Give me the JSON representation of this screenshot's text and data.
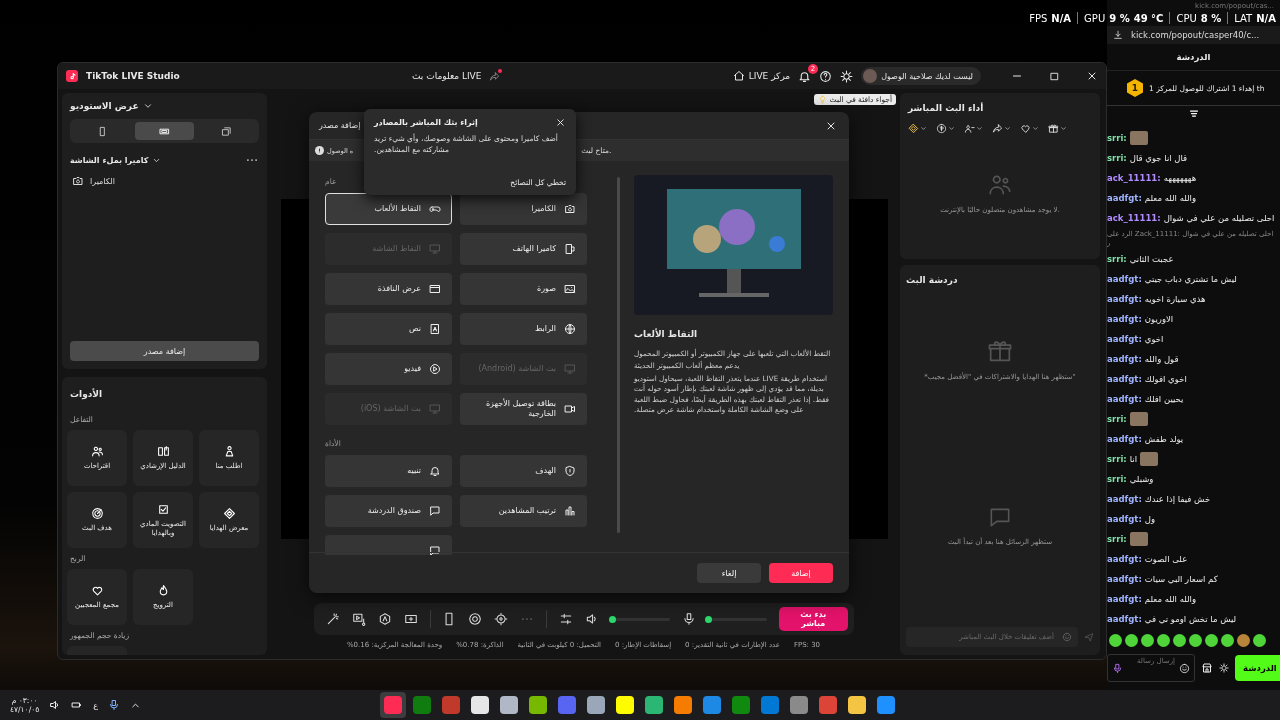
{
  "hud": {
    "fps_label": "FPS",
    "fps_value": "N/A",
    "gpu_label": "GPU",
    "gpu_usage": "9 %",
    "gpu_temp": "49 °C",
    "cpu_label": "CPU",
    "cpu_value": "8 %",
    "lat_label": "LAT",
    "lat_value": "N/A"
  },
  "studio": {
    "title": "TikTok LIVE Studio",
    "stream_info": "معلومات بث LIVE",
    "live_center": "LIVE مركز",
    "notification_count": "2",
    "account": "ليست لديك صلاحية الوصول",
    "studio_view": "عرض الاستوديو",
    "layouts": [
      {
        "kind": "portrait",
        "selected": false
      },
      {
        "kind": "landscape",
        "selected": true
      },
      {
        "kind": "dual",
        "selected": false
      }
    ],
    "scene": "كاميرا بملء الشاشة",
    "sources": [
      {
        "label": "الكاميرا",
        "kind": "camera"
      }
    ],
    "add_source": "إضافة مصدر",
    "tools_title": "الأدوات",
    "tool_groups": [
      {
        "title": "التفاعل",
        "items": [
          {
            "label": "اطلب منا",
            "kind": "pin-person"
          },
          {
            "label": "الدليل الإرشادي",
            "kind": "book"
          },
          {
            "label": "اقتراحات",
            "kind": "people"
          },
          {
            "label": "معرض الهدايا",
            "kind": "gem"
          },
          {
            "label": "التصويت المادي وبالهدايا",
            "kind": "check"
          },
          {
            "label": "هدف البث",
            "kind": "target"
          }
        ]
      },
      {
        "title": "الربح",
        "items": [
          {
            "label": "الترويج",
            "kind": "flame"
          },
          {
            "label": "مجمع المعجبين",
            "kind": "hearts"
          }
        ]
      },
      {
        "title": "زيادة حجم الجمهور",
        "items": [
          {
            "kind": "people"
          }
        ]
      }
    ],
    "hint": "أجواء دافئة في البث",
    "toolbar": [
      {
        "kind": "wand"
      },
      {
        "kind": "media"
      },
      {
        "kind": "ai"
      },
      {
        "kind": "screen-plus"
      },
      {
        "kind": "divider"
      },
      {
        "kind": "phone"
      },
      {
        "kind": "record"
      },
      {
        "kind": "focus"
      },
      {
        "kind": "more"
      },
      {
        "kind": "divider"
      },
      {
        "kind": "sliders"
      }
    ],
    "speaker_slider": {
      "level": 0.02
    },
    "mic_slider": {
      "level": 0
    },
    "go_live": "بدء بث مباشر",
    "stats": [
      "FPS: 30",
      "عدد الإطارات في ثانية التقدير: 0",
      "إسقاطات الإطار: 0",
      "التحميل: 0 كيلوبت في الثانية",
      "الذاكرة: 0.78%",
      "وحدة المعالجة المركزية: 0.16%"
    ],
    "performance": {
      "title": "أداء البث المباشر",
      "metrics": [
        {
          "kind": "gem"
        },
        {
          "kind": "coin"
        },
        {
          "kind": "viewers"
        },
        {
          "kind": "share"
        },
        {
          "kind": "heart"
        },
        {
          "kind": "gift"
        }
      ],
      "empty": "لا يوجد مشاهدون متصلون حاليًا بالإنترنت."
    },
    "live_chat": {
      "title": "دردشة البث",
      "gifts_empty": "*ستظهر هنا الهدايا والاشتراكات في \"الأفضل مجيب\"",
      "messages_empty": "ستظهر الرسائل هنا بعد أن تبدأ البث",
      "placeholder": "أضف تعليقات خلال البث المباشر"
    }
  },
  "modal": {
    "title": "إضافة مصدر",
    "notice_start": "ه الوصول",
    "notice_end": "متاح لبث.",
    "sections": [
      {
        "title": "عام",
        "items": [
          {
            "label": "الكاميرا",
            "kind": "camera",
            "selected": false,
            "disabled": false
          },
          {
            "label": "التقاط الألعاب",
            "kind": "gamepad",
            "selected": true,
            "disabled": false
          },
          {
            "label": "كاميرا الهاتف",
            "kind": "phone-camera",
            "selected": false,
            "disabled": false
          },
          {
            "label": "التقاط الشاشة",
            "kind": "monitor",
            "selected": false,
            "disabled": true
          },
          {
            "label": "صورة",
            "kind": "image",
            "selected": false,
            "disabled": false
          },
          {
            "label": "عرض النافذة",
            "kind": "window",
            "selected": false,
            "disabled": false
          },
          {
            "label": "الرابط",
            "kind": "globe",
            "selected": false,
            "disabled": false
          },
          {
            "label": "نص",
            "kind": "text",
            "selected": false,
            "disabled": false
          },
          {
            "label": "بث الشاشة (Android)",
            "kind": "monitor",
            "selected": false,
            "disabled": true
          },
          {
            "label": "فيديو",
            "kind": "play",
            "selected": false,
            "disabled": false
          },
          {
            "label": "بطاقة توصيل الأجهزة الخارجية",
            "kind": "video-card",
            "selected": false,
            "disabled": false
          },
          {
            "label": "بث الشاشة (iOS)",
            "kind": "monitor",
            "selected": false,
            "disabled": true
          }
        ]
      },
      {
        "title": "الأداة",
        "items": [
          {
            "label": "الهدف",
            "kind": "shield",
            "selected": false,
            "disabled": false
          },
          {
            "label": "تنبيه",
            "kind": "bell",
            "selected": false,
            "disabled": false
          },
          {
            "label": "ترتيب المشاهدين",
            "kind": "bars",
            "selected": false,
            "disabled": false
          },
          {
            "label": "صندوق الدردشة",
            "kind": "chat-box",
            "selected": false,
            "disabled": false
          },
          {
            "kind": "chat-box",
            "selected": false,
            "disabled": false
          }
        ]
      }
    ],
    "preview": {
      "title": "التقاط الألعاب",
      "paragraphs": [
        "التقط الألعاب التي تلعبها على جهاز الكمبيوتر أو الكمبيوتر المحمول",
        "يدعم معظم ألعاب الكمبيوتر الحديثة",
        "استخدام طريقة LIVE عندما يتعذر التقاط اللعبة، سيحاول استوديو بديلة، مما قد يؤدي إلى ظهور شاشة لعبتك بإطار أسود حوله أنت فقط. إذا تعذر التقاط لعبتك بهذه الطريقة أيضًا، فحاول ضبط اللعبة على وضع الشاشة الكاملة واستخدام شاشة عرض متصلة."
      ]
    },
    "buttons": [
      {
        "label": "إضافة",
        "kind": "primary"
      },
      {
        "label": "إلغاء",
        "kind": "secondary"
      }
    ]
  },
  "tip": {
    "title": "إثراء بثك المباشر بالمصادر",
    "body": "أضف كاميرا ومحتوى على الشاشة وصوصك، وأي شيء تريد مشاركته مع المشاهدين.",
    "skip": "تخطي كل النصائح"
  },
  "chat": {
    "tab_title": "kick.com/popout/cas...",
    "url": "kick.com/popout/casper40/c...",
    "title": "الدردشة",
    "pinned_rank": "1",
    "pinned_text": "إهداء 1 اشتراك للوصول للمركز 1 th",
    "messages": [
      {
        "kind": "image",
        "user": "srri:",
        "color": "#7fe0a8"
      },
      {
        "kind": "text",
        "user": "srri:",
        "color": "#7fe0a8",
        "text": "قال انا جوي قال"
      },
      {
        "kind": "text",
        "user": "ack_11111:",
        "color": "#b08cff",
        "text": "هههههههه"
      },
      {
        "kind": "text",
        "user": "aadfgt:",
        "color": "#9fb4ff",
        "text": "والله الله معلم"
      },
      {
        "kind": "text",
        "user": "ack_11111:",
        "color": "#b08cff",
        "text": "احلى تصليله من علي في شوال"
      },
      {
        "kind": "reply",
        "text": "الرد على Zack_11111: احلى تصليله من علي في شوال ر"
      },
      {
        "kind": "text",
        "user": "srri:",
        "color": "#7fe0a8",
        "text": "عجبت الثاني"
      },
      {
        "kind": "text",
        "user": "aadfgt:",
        "color": "#9fb4ff",
        "text": "ليش ما تشتري دباب جيتي"
      },
      {
        "kind": "text",
        "user": "aadfgt:",
        "color": "#9fb4ff",
        "text": "هذي سيارة اخويه"
      },
      {
        "kind": "text",
        "user": "aadfgt:",
        "color": "#9fb4ff",
        "text": "الاوريون"
      },
      {
        "kind": "text",
        "user": "aadfgt:",
        "color": "#9fb4ff",
        "text": "اخوي"
      },
      {
        "kind": "text",
        "user": "aadfgt:",
        "color": "#9fb4ff",
        "text": "قول والله"
      },
      {
        "kind": "text",
        "user": "aadfgt:",
        "color": "#9fb4ff",
        "text": "اخوي افولك"
      },
      {
        "kind": "text",
        "user": "aadfgt:",
        "color": "#9fb4ff",
        "text": "يحيين افلك"
      },
      {
        "kind": "image",
        "user": "srri:",
        "color": "#7fe0a8"
      },
      {
        "kind": "text",
        "user": "aadfgt:",
        "color": "#9fb4ff",
        "text": "يولد طفش"
      },
      {
        "kind": "text-image",
        "user": "srri:",
        "color": "#7fe0a8",
        "text": "انا"
      },
      {
        "kind": "text",
        "user": "srri:",
        "color": "#7fe0a8",
        "text": "وشبلي"
      },
      {
        "kind": "text",
        "user": "aadfgt:",
        "color": "#9fb4ff",
        "text": "خش فيفا إذا عندك"
      },
      {
        "kind": "text",
        "user": "aadfgt:",
        "color": "#9fb4ff",
        "text": "ول"
      },
      {
        "kind": "image",
        "user": "srri:",
        "color": "#7fe0a8"
      },
      {
        "kind": "text",
        "user": "aadfgt:",
        "color": "#9fb4ff",
        "text": "على الصوت"
      },
      {
        "kind": "text",
        "user": "aadfgt:",
        "color": "#9fb4ff",
        "text": "كم اسعار البي سيات"
      },
      {
        "kind": "text",
        "user": "aadfgt:",
        "color": "#9fb4ff",
        "text": "والله الله معلم"
      },
      {
        "kind": "text",
        "user": "aadfgt:",
        "color": "#9fb4ff",
        "text": "ليش ما تخش اومو تي في"
      }
    ],
    "emotes": [
      {
        "kind": "green"
      },
      {
        "kind": "green"
      },
      {
        "kind": "green"
      },
      {
        "kind": "green"
      },
      {
        "kind": "green"
      },
      {
        "kind": "green"
      },
      {
        "kind": "green"
      },
      {
        "kind": "green"
      },
      {
        "kind": "brown"
      },
      {
        "kind": "green"
      }
    ],
    "message_placeholder": "إرسال رسالة",
    "chat_button": "الدردشة"
  },
  "taskbar": {
    "time": "٠٣:٠٠ م",
    "date": "٤٧/١٠/٠٥",
    "language": "ع",
    "apps": [
      {
        "color": "#fe2c55",
        "selected": true
      },
      {
        "color": "#107c10",
        "selected": false
      },
      {
        "color": "#c0392b",
        "selected": false
      },
      {
        "color": "#e6e6e6",
        "selected": false
      },
      {
        "color": "#b0b8c8",
        "selected": false
      },
      {
        "color": "#76b900",
        "selected": false
      },
      {
        "color": "#5865f2",
        "selected": false
      },
      {
        "color": "#9aa7b8",
        "selected": false
      },
      {
        "color": "#fffc00",
        "selected": false
      },
      {
        "color": "#2bb673",
        "selected": false
      },
      {
        "color": "#f57c00",
        "selected": false
      },
      {
        "color": "#1e88e5",
        "selected": false
      },
      {
        "color": "#0f8a0f",
        "selected": false
      },
      {
        "color": "#0078d4",
        "selected": false
      },
      {
        "color": "#8a8a8a",
        "selected": false
      },
      {
        "color": "#db4437",
        "selected": false
      },
      {
        "color": "#f4c542",
        "selected": false
      },
      {
        "color": "#1e90ff",
        "selected": false
      }
    ]
  }
}
